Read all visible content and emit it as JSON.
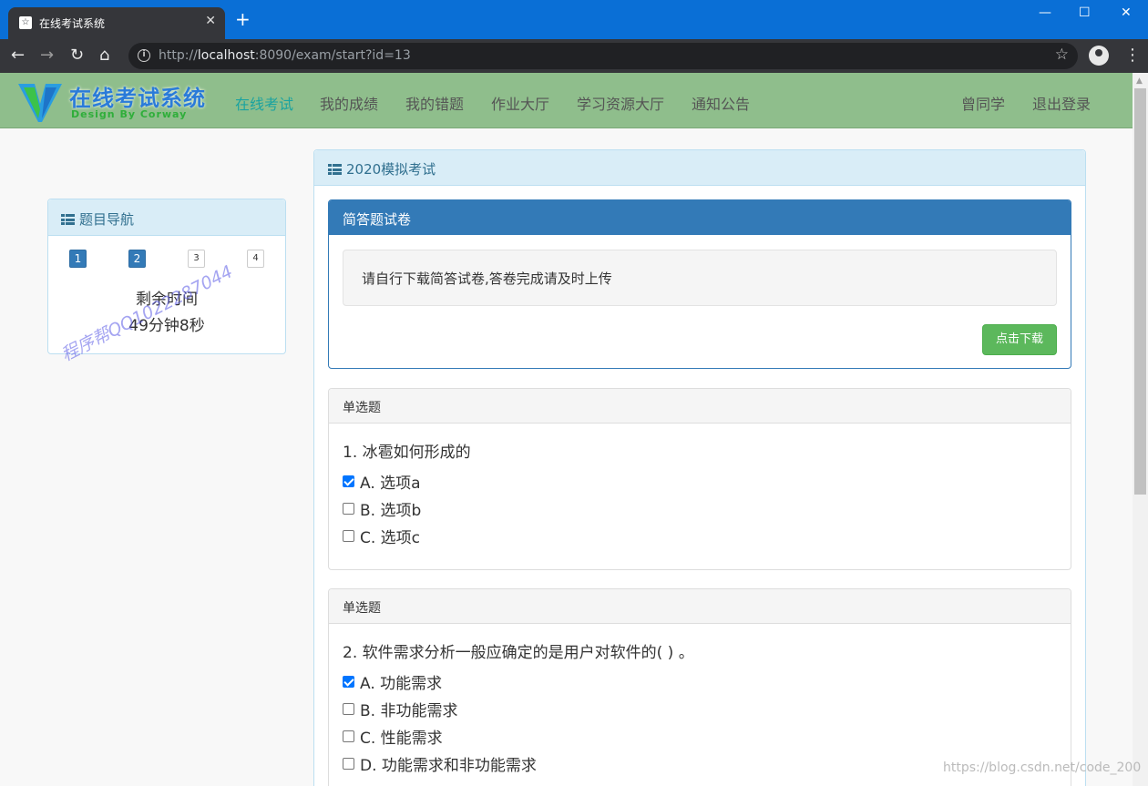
{
  "browser": {
    "tab_title": "在线考试系统",
    "tab_close": "✕",
    "new_tab": "+",
    "url_scheme": "http://",
    "url_host": "localhost",
    "url_rest": ":8090/exam/start?id=13",
    "window_controls": {
      "minimize": "—",
      "maximize": "☐",
      "close": "✕"
    },
    "icons": {
      "back": "←",
      "forward": "→",
      "reload": "↻",
      "home": "⌂",
      "info": "i",
      "star": "☆",
      "menu": "⋮"
    }
  },
  "site": {
    "logo_title": "在线考试系统",
    "logo_subtitle": "Design By Corway",
    "nav": [
      "在线考试",
      "我的成绩",
      "我的错题",
      "作业大厅",
      "学习资源大厅",
      "通知公告"
    ],
    "active_nav": 0,
    "user": "曾同学",
    "logout": "退出登录",
    "colors": {
      "navbar": "#8fbe8c",
      "active_nav": "#1ba3a0",
      "logo_blue": "#2a7bd9"
    }
  },
  "question_nav": {
    "title": "题目导航",
    "buttons": [
      {
        "label": "1",
        "answered": true
      },
      {
        "label": "2",
        "answered": true
      },
      {
        "label": "3",
        "answered": false
      },
      {
        "label": "4",
        "answered": false
      }
    ],
    "timer_label": "剩余时间",
    "timer_value": "49分钟8秒"
  },
  "watermark": "程序帮QQ1022287044",
  "exam": {
    "title": "2020模拟考试",
    "essay": {
      "title": "简答题试卷",
      "notice": "请自行下载简答试卷,答卷完成请及时上传",
      "download_label": "点击下载"
    },
    "questions": [
      {
        "type": "单选题",
        "text": "1. 冰雹如何形成的",
        "options": [
          {
            "label": "A. 选项a",
            "checked": true
          },
          {
            "label": "B. 选项b",
            "checked": false
          },
          {
            "label": "C. 选项c",
            "checked": false
          }
        ]
      },
      {
        "type": "单选题",
        "text": "2. 软件需求分析一般应确定的是用户对软件的( ) 。",
        "options": [
          {
            "label": "A. 功能需求",
            "checked": true
          },
          {
            "label": "B. 非功能需求",
            "checked": false
          },
          {
            "label": "C. 性能需求",
            "checked": false
          },
          {
            "label": "D. 功能需求和非功能需求",
            "checked": false
          }
        ]
      }
    ]
  },
  "page_watermark": "https://blog.csdn.net/code_200"
}
